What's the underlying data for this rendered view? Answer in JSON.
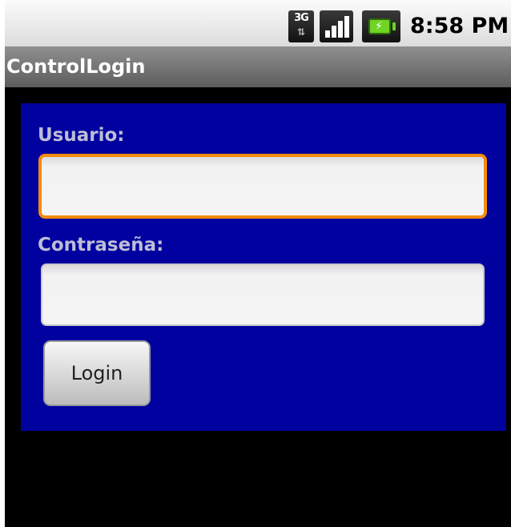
{
  "status_bar": {
    "network_label": "3G",
    "network_arrows": "⇅",
    "time": "8:58 PM",
    "icons": [
      "3g-icon",
      "signal-icon",
      "battery-icon"
    ],
    "signal_bars": 4,
    "battery_charging": true
  },
  "app": {
    "title": "ControlLogin"
  },
  "form": {
    "background_color": "#0101a0",
    "username_label": "Usuario:",
    "username_value": "",
    "password_label": "Contraseña:",
    "password_value": "",
    "login_label": "Login",
    "focus_color": "#f58a0e"
  }
}
